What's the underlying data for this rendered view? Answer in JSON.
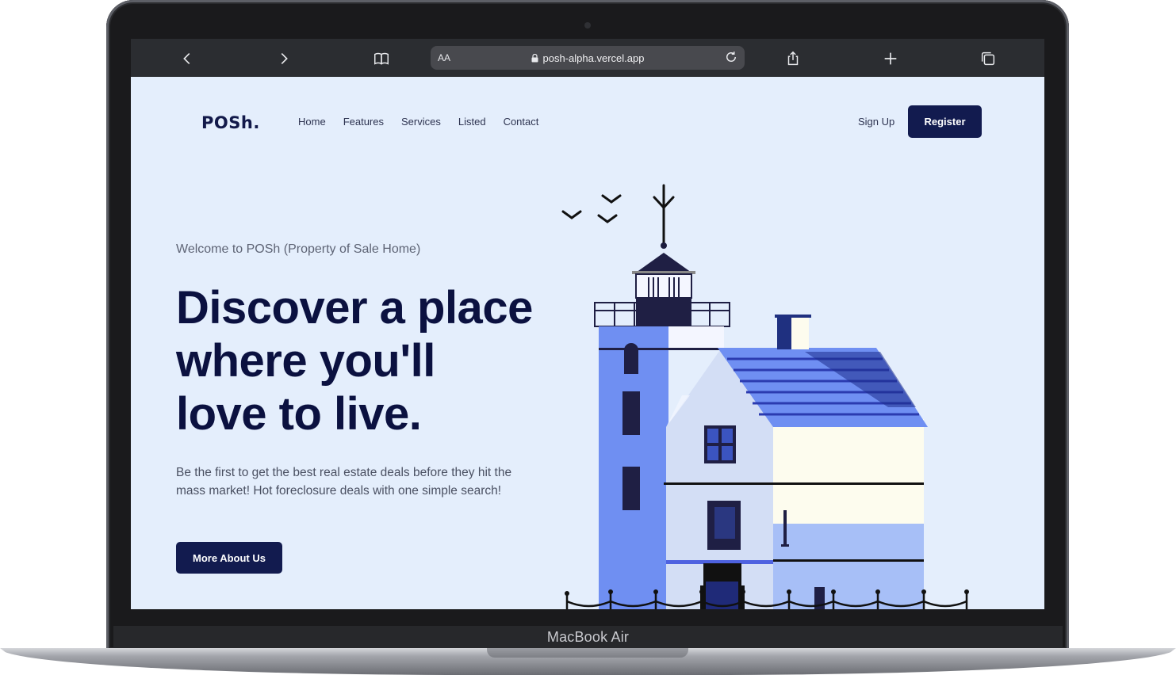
{
  "device": {
    "brand_label": "MacBook Air"
  },
  "browser": {
    "aa_label": "AA",
    "url": "posh-alpha.vercel.app",
    "icons": [
      "back-icon",
      "forward-icon",
      "bookmarks-icon",
      "lock-icon",
      "reload-icon",
      "share-icon",
      "new-tab-icon",
      "tabs-icon"
    ]
  },
  "site": {
    "logo": "POSh.",
    "nav": [
      "Home",
      "Features",
      "Services",
      "Listed",
      "Contact"
    ],
    "sign_up": "Sign Up",
    "register": "Register",
    "welcome": "Welcome to POSh (Property of Sale Home)",
    "headline": [
      "Discover a place",
      "where you'll",
      "love to live."
    ],
    "subtext": "Be the first to get the best real estate deals before they hit the mass market! Hot foreclosure deals with one simple search!",
    "more_button": "More About Us"
  },
  "colors": {
    "page_bg": "#e4eefc",
    "primary": "#121b4f",
    "heading": "#0b1140",
    "browser_bar": "#2b2d31"
  }
}
